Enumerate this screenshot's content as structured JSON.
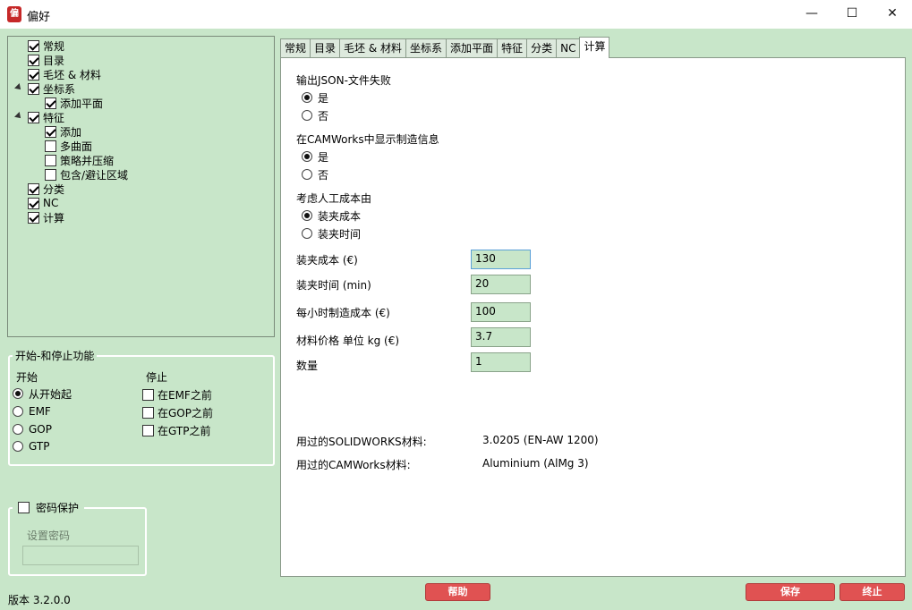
{
  "window": {
    "title": "偏好",
    "icon_glyph": "偏",
    "minimize": "—",
    "maximize": "☐",
    "close": "✕"
  },
  "tree": {
    "items": [
      {
        "label": "常规",
        "checked": true
      },
      {
        "label": "目录",
        "checked": true
      },
      {
        "label": "毛坯 & 材料",
        "checked": true
      },
      {
        "label": "坐标系",
        "checked": true
      },
      {
        "label": "添加平面",
        "checked": true
      },
      {
        "label": "特征",
        "checked": true
      },
      {
        "label": "添加",
        "checked": true
      },
      {
        "label": "多曲面",
        "checked": false
      },
      {
        "label": "策略并压缩",
        "checked": false
      },
      {
        "label": "包含/避让区域",
        "checked": false
      },
      {
        "label": "分类",
        "checked": true
      },
      {
        "label": "NC",
        "checked": true
      },
      {
        "label": "计算",
        "checked": true
      }
    ]
  },
  "startstop": {
    "title": "开始-和停止功能",
    "start_label": "开始",
    "stop_label": "停止",
    "start_options": [
      "从开始起",
      "EMF",
      "GOP",
      "GTP"
    ],
    "start_selected": 0,
    "stop_options": [
      "在EMF之前",
      "在GOP之前",
      "在GTP之前"
    ]
  },
  "password": {
    "checkbox_label": "密码保护",
    "set_label": "设置密码",
    "value": ""
  },
  "version": "版本 3.2.0.0",
  "tabs": [
    "常规",
    "目录",
    "毛坯 & 材料",
    "坐标系",
    "添加平面",
    "特征",
    "分类",
    "NC",
    "计算"
  ],
  "active_tab": 8,
  "calc": {
    "json_fail": {
      "label": "输出JSON-文件失败",
      "options": [
        "是",
        "否"
      ],
      "selected": 0
    },
    "camworks_info": {
      "label": "在CAMWorks中显示制造信息",
      "options": [
        "是",
        "否"
      ],
      "selected": 0
    },
    "labor_cost": {
      "label": "考虑人工成本由",
      "options": [
        "装夹成本",
        "装夹时间"
      ],
      "selected": 0
    },
    "fields": [
      {
        "label": "装夹成本 (€)",
        "value": "130"
      },
      {
        "label": "装夹时间 (min)",
        "value": "20"
      },
      {
        "label": "每小时制造成本 (€)",
        "value": "100"
      },
      {
        "label": "材料价格 单位 kg (€)",
        "value": "3.7"
      },
      {
        "label": "数量",
        "value": "1"
      }
    ],
    "sw_material_label": "用过的SOLIDWORKS材料:",
    "sw_material_value": "3.0205 (EN-AW 1200)",
    "cw_material_label": "用过的CAMWorks材料:",
    "cw_material_value": "Aluminium (AlMg 3)"
  },
  "buttons": {
    "help": "帮助",
    "save": "保存",
    "stop": "终止"
  },
  "colors": {
    "panel_bg": "#c8e6c9",
    "button": "#e05252"
  }
}
